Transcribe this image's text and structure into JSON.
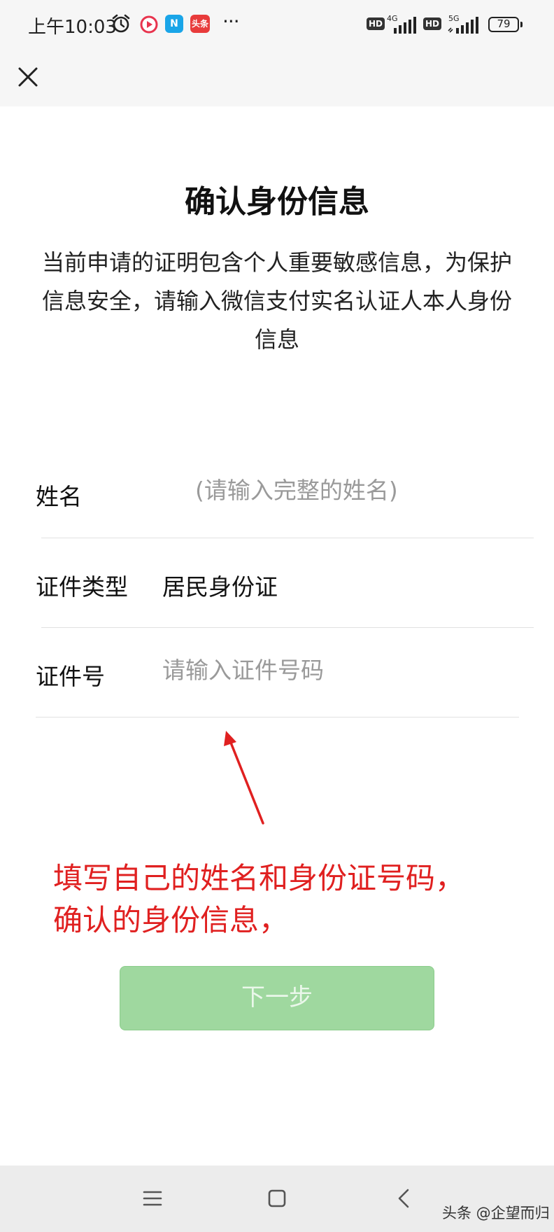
{
  "status_bar": {
    "time": "上午10:03",
    "app_n_label": "N",
    "app_toutiao_label": "头条",
    "more_dots": "···",
    "hd_label_1": "HD",
    "network_1": "4G",
    "hd_label_2": "HD",
    "network_2": "5G",
    "battery": "79"
  },
  "page": {
    "title": "确认身份信息",
    "description": "当前申请的证明包含个人重要敏感信息，为保护信息安全，请输入微信支付实名认证人本人身份信息"
  },
  "form": {
    "name_label": "姓名",
    "name_placeholder": "(请输入完整的姓名)",
    "id_type_label": "证件类型",
    "id_type_value": "居民身份证",
    "id_number_label": "证件号",
    "id_number_placeholder": "请输入证件号码"
  },
  "annotation": {
    "line1": "填写自己的姓名和身份证号码，",
    "line2": "确认的身份信息，",
    "color": "#e02020"
  },
  "button": {
    "next_label": "下一步",
    "bg_color": "#9fd89f"
  },
  "watermark": "头条 @企望而归"
}
